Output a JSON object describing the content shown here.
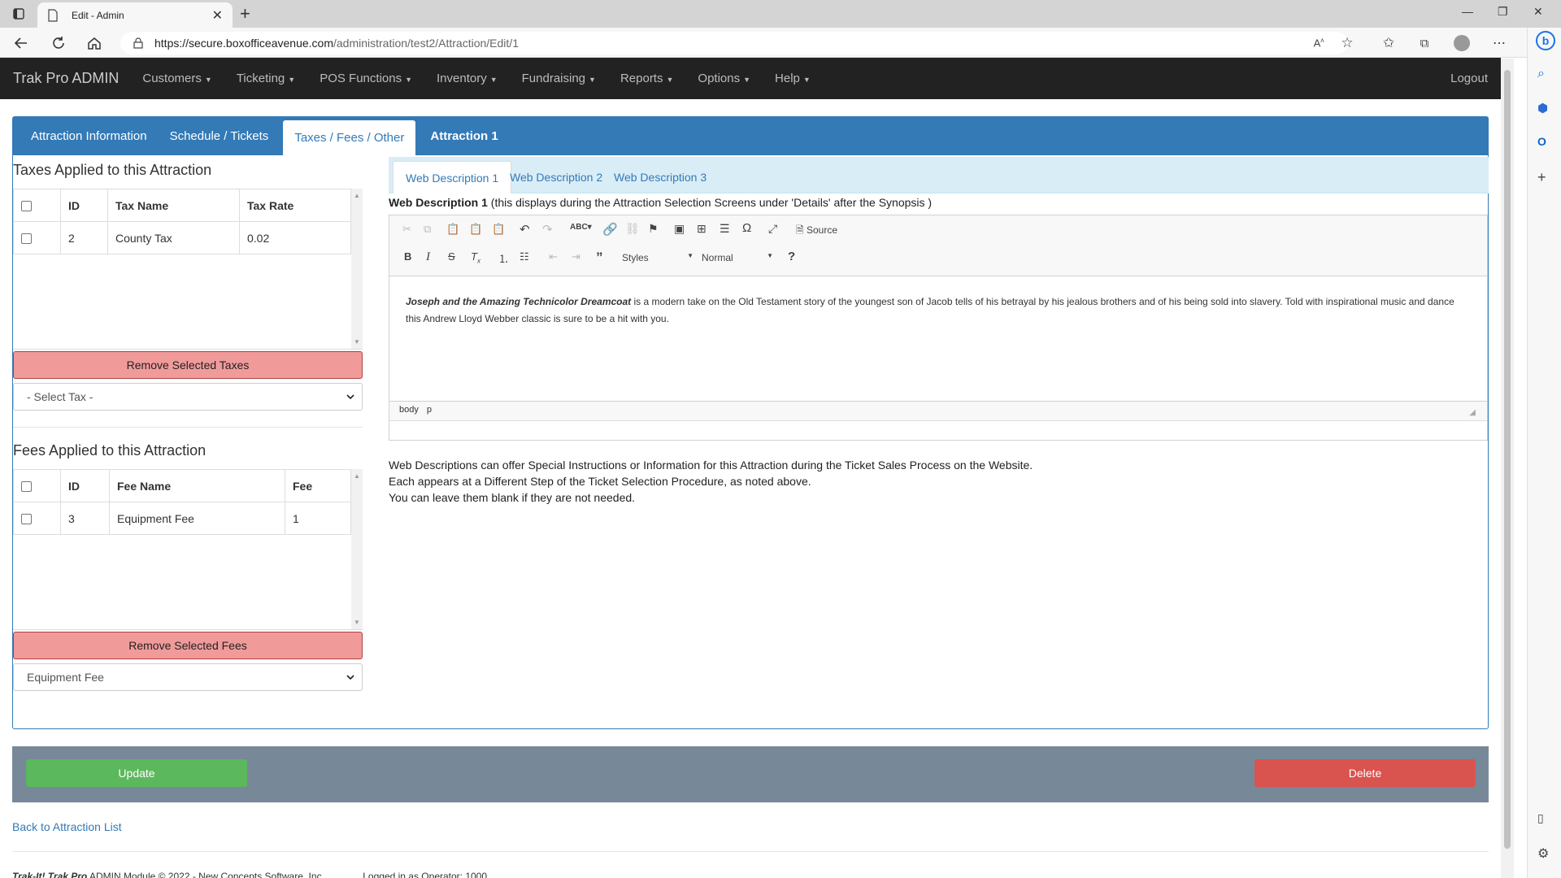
{
  "browser": {
    "tab_title": "Edit - Admin",
    "url_host": "https://secure.boxofficeavenue.com",
    "url_path": "/administration/test2/Attraction/Edit/1"
  },
  "app": {
    "brand": "Trak Pro ADMIN",
    "menu": [
      "Customers",
      "Ticketing",
      "POS Functions",
      "Inventory",
      "Fundraising",
      "Reports",
      "Options",
      "Help"
    ],
    "logout": "Logout"
  },
  "tabs": {
    "attraction_info": "Attraction Information",
    "schedule": "Schedule / Tickets",
    "taxes_fees": "Taxes / Fees / Other",
    "attraction_name": "Attraction 1"
  },
  "taxes": {
    "heading": "Taxes Applied to this Attraction",
    "columns": [
      "ID",
      "Tax Name",
      "Tax Rate"
    ],
    "rows": [
      {
        "id": "2",
        "name": "County Tax",
        "rate": "0.02"
      }
    ],
    "remove_label": "Remove Selected Taxes",
    "select_value": "- Select Tax -"
  },
  "fees": {
    "heading": "Fees Applied to this Attraction",
    "columns": [
      "ID",
      "Fee Name",
      "Fee"
    ],
    "rows": [
      {
        "id": "3",
        "name": "Equipment Fee",
        "fee": "1"
      }
    ],
    "remove_label": "Remove Selected Fees",
    "select_value": "Equipment Fee"
  },
  "web_desc": {
    "tabs": [
      "Web Description 1",
      "Web Description 2",
      "Web Description 3"
    ],
    "caption_bold": "Web Description 1",
    "caption_rest": " (this displays during the Attraction Selection Screens under 'Details' after the Synopsis )",
    "toolbar": {
      "source": "Source",
      "styles": "Styles",
      "format": "Normal"
    },
    "body_title": "Joseph and the Amazing Technicolor Dreamcoat",
    "body_text": " is a modern take on the Old Testament story of the youngest son of Jacob tells of his betrayal by his jealous brothers and of his being sold into slavery.  Told with inspirational music and dance this Andrew Lloyd Webber classic is sure to be a hit with you.",
    "path": [
      "body",
      "p"
    ],
    "help": [
      "Web Descriptions can offer Special Instructions or Information for this Attraction during the Ticket Sales Process on the Website.",
      "Each appears at a Different Step of the Ticket Selection Procedure, as noted above.",
      "You can leave them blank if they are not needed."
    ]
  },
  "actions": {
    "update": "Update",
    "delete": "Delete"
  },
  "back_link": "Back to Attraction List",
  "footer": {
    "brand": "Trak-It! Trak Pro",
    "text": " ADMIN Module © 2022 - New Concepts Software, Inc.",
    "operator": "Logged in as Operator: 1000"
  },
  "colors": {
    "navbar": "#222222",
    "panel_blue": "#337ab7",
    "update_green": "#5cb85c",
    "delete_red": "#d9534f",
    "remove_pink": "#f19a9a"
  }
}
